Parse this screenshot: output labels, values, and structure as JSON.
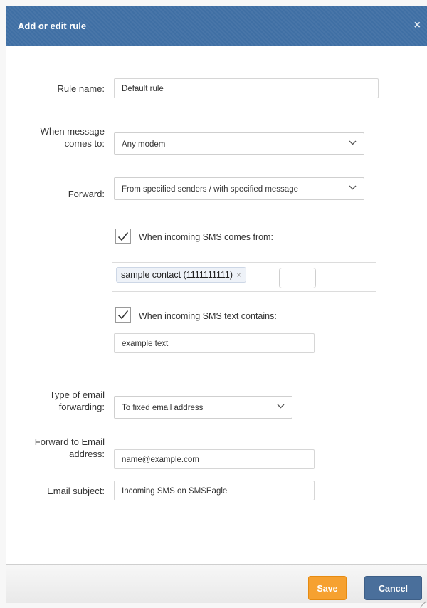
{
  "dialog": {
    "title": "Add or edit rule",
    "close_icon": "×"
  },
  "form": {
    "rule_name": {
      "label": "Rule name:",
      "value": "Default rule"
    },
    "message_to": {
      "label_line1": "When message",
      "label_line2": "comes to:",
      "value": "Any modem"
    },
    "forward": {
      "label": "Forward:",
      "value": "From specified senders / with specified message"
    },
    "sender_condition": {
      "checked": true,
      "label": "When incoming SMS comes from:",
      "tags": [
        {
          "text": "sample contact (1111111111)",
          "remove": "×"
        }
      ]
    },
    "text_condition": {
      "checked": true,
      "label": "When incoming SMS text contains:",
      "value": "example text"
    },
    "email_forwarding_type": {
      "label_line1": "Type of email",
      "label_line2": "forwarding:",
      "value": "To fixed email address"
    },
    "forward_email": {
      "label_line1": "Forward to Email",
      "label_line2": "address:",
      "value": "name@example.com"
    },
    "email_subject": {
      "label": "Email subject:",
      "value": "Incoming SMS on SMSEagle"
    }
  },
  "footer": {
    "save_label": "Save",
    "cancel_label": "Cancel"
  },
  "colors": {
    "title_bar": "#3f6fa4",
    "save": "#f6a130",
    "cancel": "#4a6f9b"
  }
}
